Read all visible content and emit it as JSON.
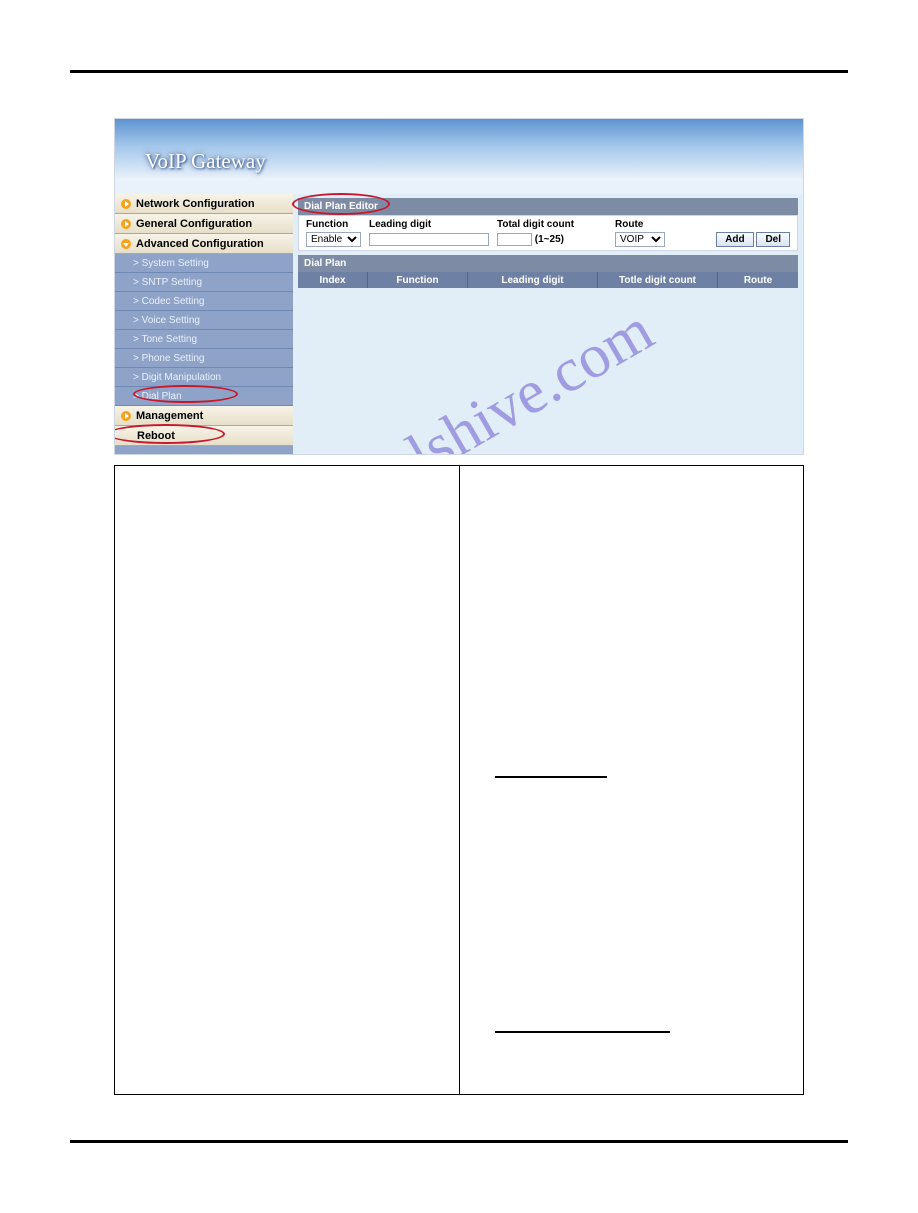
{
  "header_title": "VoIP  Gateway",
  "watermark": "manualshive.com",
  "nav": {
    "top": [
      {
        "label": "Network Configuration"
      },
      {
        "label": "General Configuration"
      },
      {
        "label": "Advanced Configuration"
      }
    ],
    "subs": [
      "> System Setting",
      "> SNTP Setting",
      "> Codec Setting",
      "> Voice Setting",
      "> Tone Setting",
      "> Phone Setting",
      "> Digit Manipulation",
      "> Dial Plan"
    ],
    "management": "Management",
    "reboot": "Reboot"
  },
  "panel": {
    "title": "Dial Plan Editor",
    "cols": {
      "function": "Function",
      "leading": "Leading digit",
      "total": "Total digit count",
      "route": "Route"
    },
    "function_value": "Enable",
    "total_hint": "(1~25)",
    "route_value": "VOIP",
    "buttons": {
      "add": "Add",
      "del": "Del"
    },
    "table_title": "Dial Plan",
    "table_head": {
      "index": "Index",
      "function": "Function",
      "leading": "Leading digit",
      "total": "Totle digit count",
      "route": "Route"
    }
  }
}
